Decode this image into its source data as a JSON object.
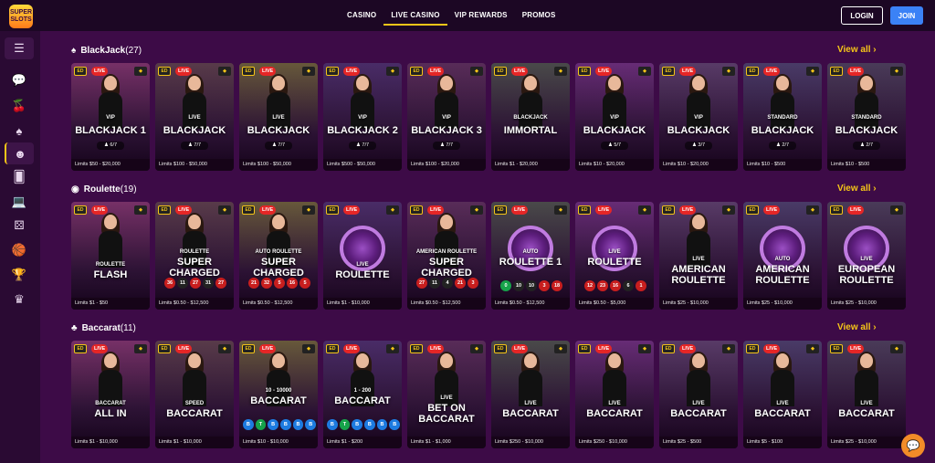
{
  "brand": {
    "logo_text_1": "SUPER",
    "logo_text_2": "SLOTS"
  },
  "nav": {
    "items": [
      "CASINO",
      "LIVE CASINO",
      "VIP REWARDS",
      "PROMOS"
    ],
    "active": "LIVE CASINO"
  },
  "auth": {
    "login": "LOGIN",
    "join": "JOIN"
  },
  "sidebar": {
    "icons": [
      "menu-icon",
      "chat-bubbles-icon",
      "cherries-icon",
      "spade-icon",
      "live-dealer-icon",
      "cards-icon",
      "laptop-icon",
      "dice-icon",
      "basketball-icon",
      "trophy-icon",
      "crown-icon"
    ]
  },
  "sections": [
    {
      "title": "BlackJack",
      "count": "(27)",
      "view_all": "View all",
      "cards": [
        {
          "sub": "VIP",
          "title": "BLACKJACK 1",
          "seats": "6/7",
          "limits": "Limits $50 - $20,000"
        },
        {
          "sub": "LIVE",
          "title": "BLACKJACK",
          "seats": "7/7",
          "limits": "Limits $100 - $50,000"
        },
        {
          "sub": "LIVE",
          "title": "BLACKJACK",
          "seats": "7/7",
          "limits": "Limits $100 - $50,000"
        },
        {
          "sub": "VIP",
          "title": "BLACKJACK 2",
          "seats": "7/7",
          "limits": "Limits $500 - $50,000"
        },
        {
          "sub": "VIP",
          "title": "BLACKJACK 3",
          "seats": "7/7",
          "limits": "Limits $100 - $20,000"
        },
        {
          "sub": "BLACKJACK",
          "title": "IMMORTAL",
          "seats": "",
          "limits": "Limits $1 - $20,000"
        },
        {
          "sub": "VIP",
          "title": "BLACKJACK",
          "seats": "5/7",
          "limits": "Limits $10 - $20,000"
        },
        {
          "sub": "VIP",
          "title": "BLACKJACK",
          "seats": "3/7",
          "limits": "Limits $10 - $20,000"
        },
        {
          "sub": "STANDARD",
          "title": "BLACKJACK",
          "seats": "2/7",
          "limits": "Limits $10 - $500"
        },
        {
          "sub": "STANDARD",
          "title": "BLACKJACK",
          "seats": "2/7",
          "limits": "Limits $10 - $500"
        }
      ]
    },
    {
      "title": "Roulette",
      "count": "(19)",
      "view_all": "View all",
      "cards": [
        {
          "sub": "ROULETTE",
          "title": "FLASH",
          "limits": "Limits $1 - $50",
          "nums": []
        },
        {
          "sub": "ROULETTE",
          "title": "SUPER CHARGED",
          "limits": "Limits $0.50 - $12,500",
          "nums": [
            [
              "36",
              "r"
            ],
            [
              "11",
              "b"
            ],
            [
              "27",
              "r"
            ],
            [
              "31",
              "b"
            ],
            [
              "27",
              "r"
            ]
          ]
        },
        {
          "sub": "AUTO ROULETTE",
          "title": "SUPER CHARGED",
          "limits": "Limits $0.50 - $12,500",
          "nums": [
            [
              "21",
              "r"
            ],
            [
              "32",
              "r"
            ],
            [
              "5",
              "r"
            ],
            [
              "16",
              "r"
            ],
            [
              "5",
              "r"
            ]
          ]
        },
        {
          "sub": "LIVE",
          "title": "ROULETTE",
          "limits": "Limits $1 - $10,000",
          "nums": []
        },
        {
          "sub": "AMERICAN ROULETTE",
          "title": "SUPER CHARGED",
          "limits": "Limits $0.50 - $12,500",
          "nums": [
            [
              "27",
              "r"
            ],
            [
              "11",
              "b"
            ],
            [
              "4",
              "b"
            ],
            [
              "21",
              "r"
            ],
            [
              "3",
              "r"
            ]
          ]
        },
        {
          "sub": "AUTO",
          "title": "ROULETTE 1",
          "limits": "Limits $0.50 - $12,500",
          "nums": [
            [
              "0",
              "g"
            ],
            [
              "10",
              "b"
            ],
            [
              "10",
              "b"
            ],
            [
              "3",
              "r"
            ],
            [
              "18",
              "r"
            ]
          ]
        },
        {
          "sub": "LIVE",
          "title": "ROULETTE",
          "limits": "Limits $0.50 - $5,000",
          "nums": [
            [
              "12",
              "r"
            ],
            [
              "23",
              "r"
            ],
            [
              "16",
              "r"
            ],
            [
              "6",
              "b"
            ],
            [
              "1",
              "r"
            ]
          ]
        },
        {
          "sub": "LIVE",
          "title": "AMERICAN ROULETTE",
          "limits": "Limits $25 - $10,000",
          "nums": []
        },
        {
          "sub": "AUTO",
          "title": "AMERICAN ROULETTE",
          "limits": "Limits $25 - $10,000",
          "nums": []
        },
        {
          "sub": "LIVE",
          "title": "EUROPEAN ROULETTE",
          "limits": "Limits $25 - $10,000",
          "nums": []
        }
      ]
    },
    {
      "title": "Baccarat",
      "count": "(11)",
      "view_all": "View all",
      "cards": [
        {
          "sub": "BACCARAT",
          "title": "ALL IN",
          "limits": "Limits $1 - $10,000",
          "nums": []
        },
        {
          "sub": "SPEED",
          "title": "BACCARAT",
          "limits": "Limits $1 - $10,000",
          "nums": []
        },
        {
          "sub": "10 - 10000",
          "title": "BACCARAT",
          "limits": "Limits $10 - $10,000",
          "nums": [
            [
              "B",
              "u"
            ],
            [
              "T",
              "g"
            ],
            [
              "B",
              "u"
            ],
            [
              "B",
              "u"
            ],
            [
              "B",
              "u"
            ],
            [
              "B",
              "u"
            ]
          ]
        },
        {
          "sub": "1 - 200",
          "title": "BACCARAT",
          "limits": "Limits $1 - $200",
          "nums": [
            [
              "B",
              "u"
            ],
            [
              "T",
              "g"
            ],
            [
              "B",
              "u"
            ],
            [
              "B",
              "u"
            ],
            [
              "B",
              "u"
            ],
            [
              "B",
              "u"
            ]
          ]
        },
        {
          "sub": "LIVE",
          "title": "BET ON BACCARAT",
          "limits": "Limits $1 - $1,000",
          "nums": []
        },
        {
          "sub": "LIVE",
          "title": "BACCARAT",
          "limits": "Limits $250 - $10,000",
          "nums": []
        },
        {
          "sub": "LIVE",
          "title": "BACCARAT",
          "limits": "Limits $250 - $10,000",
          "nums": []
        },
        {
          "sub": "LIVE",
          "title": "BACCARAT",
          "limits": "Limits $25 - $500",
          "nums": []
        },
        {
          "sub": "LIVE",
          "title": "BACCARAT",
          "limits": "Limits $5 - $100",
          "nums": []
        },
        {
          "sub": "LIVE",
          "title": "BACCARAT",
          "limits": "Limits $25 - $10,000",
          "nums": []
        }
      ]
    }
  ],
  "live_badge": "LIVE",
  "colors": {
    "accent": "#f5c518",
    "background": "#3d0b47",
    "join": "#3b82f6",
    "live": "#e52626"
  }
}
